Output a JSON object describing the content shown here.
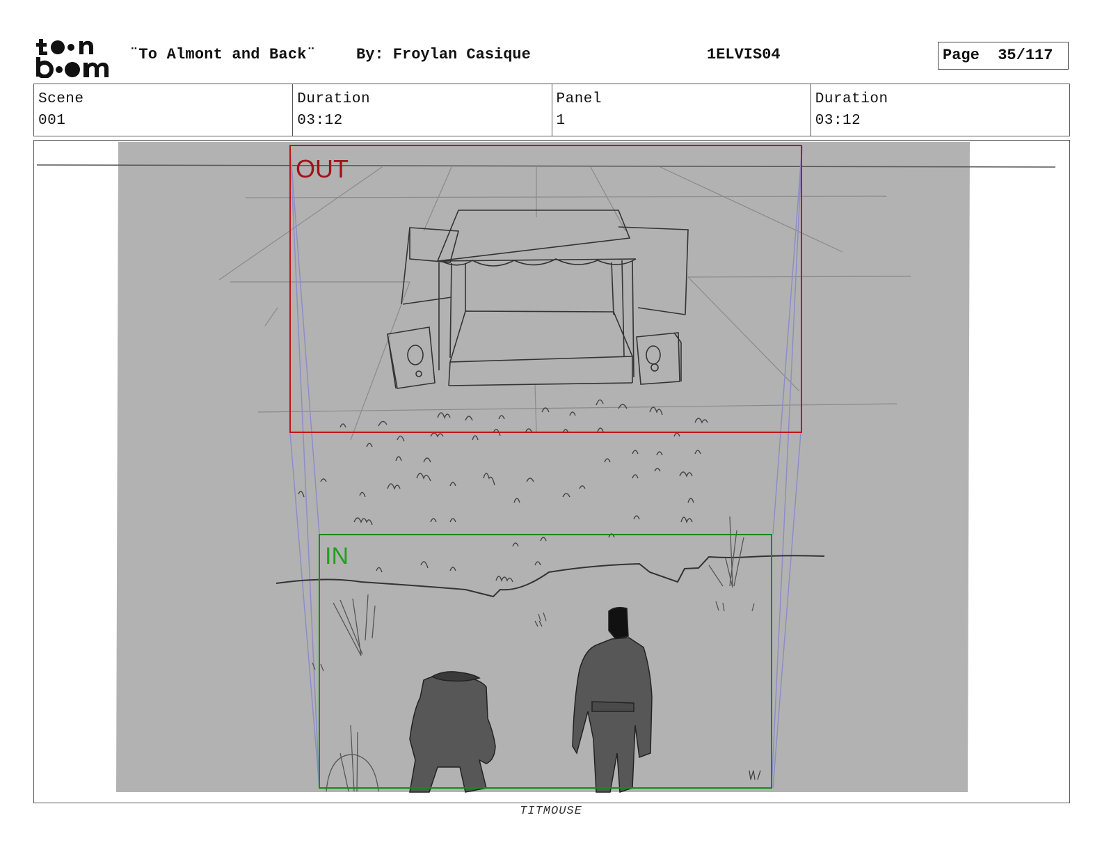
{
  "header": {
    "title": "¨To Almont and Back¨",
    "author": "By: Froylan Casique",
    "episode_code": "1ELVIS04",
    "page": "Page  35/117"
  },
  "info": {
    "scene_label": "Scene",
    "scene_value": "001",
    "scene_duration_label": "Duration",
    "scene_duration_value": "03:12",
    "panel_label": "Panel",
    "panel_value": "1",
    "panel_duration_label": "Duration",
    "panel_duration_value": "03:12"
  },
  "panel": {
    "out_label": "OUT",
    "in_label": "IN",
    "out_color": "#c0141c",
    "in_color": "#1a8a1a",
    "sketch_bg": "#b2b2b2"
  },
  "footer": "TITMOUSE"
}
